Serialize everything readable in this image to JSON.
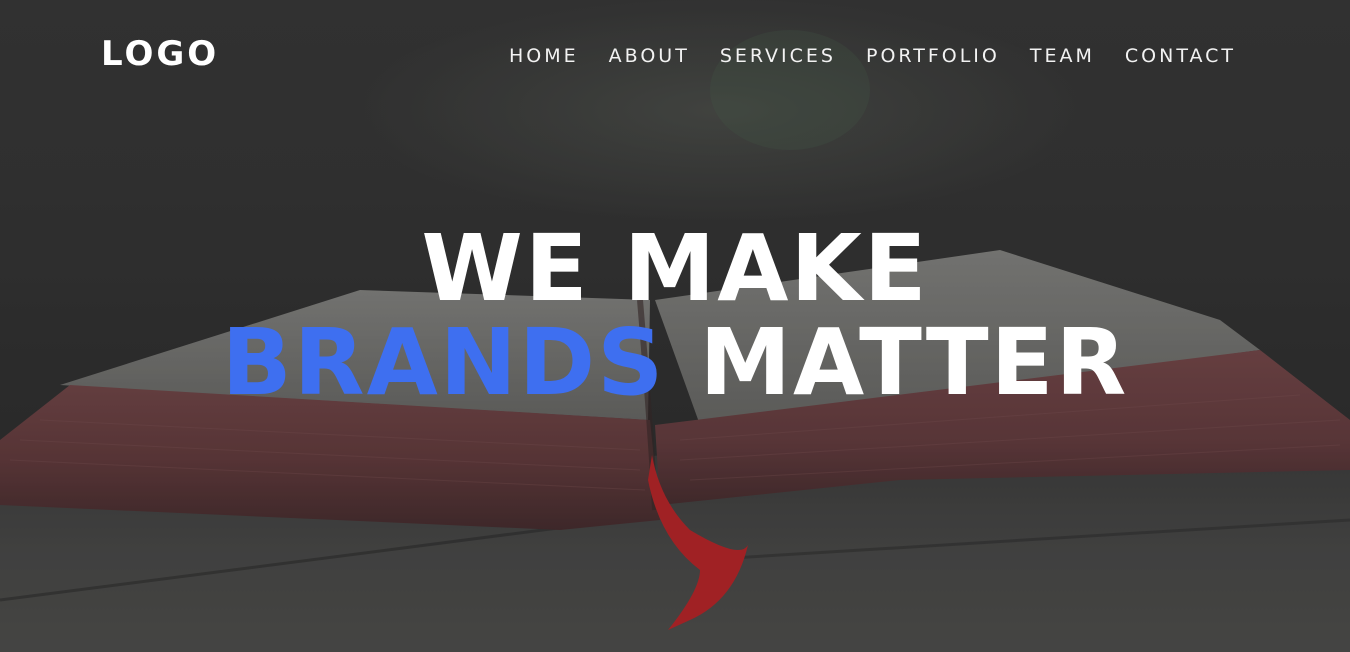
{
  "brand": {
    "logo_text": "LOGO"
  },
  "nav": {
    "items": [
      {
        "label": "HOME"
      },
      {
        "label": "ABOUT"
      },
      {
        "label": "SERVICES"
      },
      {
        "label": "PORTFOLIO"
      },
      {
        "label": "TEAM"
      },
      {
        "label": "CONTACT"
      }
    ]
  },
  "hero": {
    "headline_line1": "WE MAKE",
    "headline_accent": "BRANDS",
    "headline_rest": "MATTER",
    "background_image": "open-book-with-red-ribbon-bookmark"
  },
  "colors": {
    "accent": "#3e6ff0",
    "text": "#ffffff",
    "overlay": "#2e2e2e"
  }
}
